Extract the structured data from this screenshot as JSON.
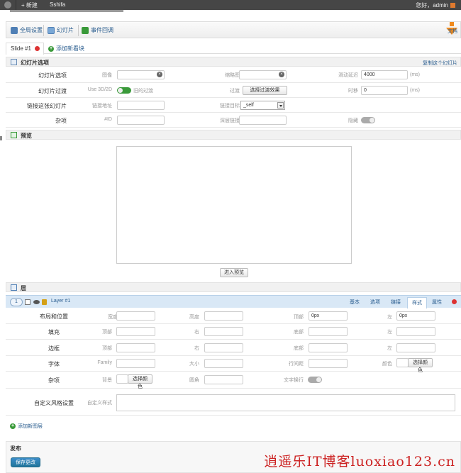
{
  "adminbar": {
    "new_label": "+ 新建",
    "site": "Sshifa",
    "greeting": "您好，admin"
  },
  "toolbar": {
    "global_settings": "全局设置",
    "slides": "幻灯片",
    "event_callbacks": "事件回调",
    "docs": "文档"
  },
  "slide_tabs": {
    "current": "Slide #1",
    "add_module": "添加新看块"
  },
  "slide_options": {
    "header": "幻灯片选项",
    "copy_link": "复制这个幻灯片",
    "row1": {
      "label": "幻灯片选项",
      "image": "图像",
      "thumbnail": "缩略图",
      "delay": "滑动延迟",
      "delay_value": "4000",
      "unit": "(ms)"
    },
    "row2": {
      "label": "幻灯片过渡",
      "use_3d2d": "Use 3D/2D",
      "old_transition": "旧的过渡",
      "transition": "过渡",
      "transition_btn": "选择过渡效果",
      "shift": "时移",
      "shift_value": "0",
      "unit": "(ms)"
    },
    "row3": {
      "label": "链接这张幻灯片",
      "link_url": "链接地址",
      "link_target": "链接目标",
      "target_value": "_self"
    },
    "row4": {
      "label": "杂项",
      "id": "#ID",
      "deeplink": "深层链接",
      "hidden": "隐藏"
    }
  },
  "preview": {
    "header": "预览",
    "enter_preview": "进入预览"
  },
  "layers": {
    "header": "层",
    "layer_num": "1",
    "layer_name": "Layer #1",
    "tabs": [
      "基本",
      "选项",
      "链接",
      "样式",
      "属性"
    ],
    "active_tab": "样式",
    "rows": {
      "layout": {
        "label": "布局和位置",
        "width": "宽度",
        "height": "高度",
        "top": "顶部",
        "top_value": "0px",
        "left": "左",
        "left_value": "0px"
      },
      "padding": {
        "label": "填充",
        "top": "顶部",
        "right": "右",
        "bottom": "底部",
        "left": "左"
      },
      "border": {
        "label": "边框",
        "top": "顶部",
        "right": "右",
        "bottom": "底部",
        "left": "左"
      },
      "font": {
        "label": "字体",
        "family": "Family",
        "size": "大小",
        "line_height": "行间距",
        "color": "颜色",
        "pick_color": "选择颜色"
      },
      "misc": {
        "label": "杂项",
        "background": "背景",
        "pick_color": "选择颜色",
        "radius": "圆角",
        "wrap": "文字换行"
      },
      "custom": {
        "label": "自定义风格设置",
        "custom_style": "自定义样式"
      }
    },
    "add_layer": "添加新图层"
  },
  "publish": {
    "header": "发布",
    "save": "保存更改"
  },
  "watermark": "逍遥乐IT博客luoxiao123.cn"
}
